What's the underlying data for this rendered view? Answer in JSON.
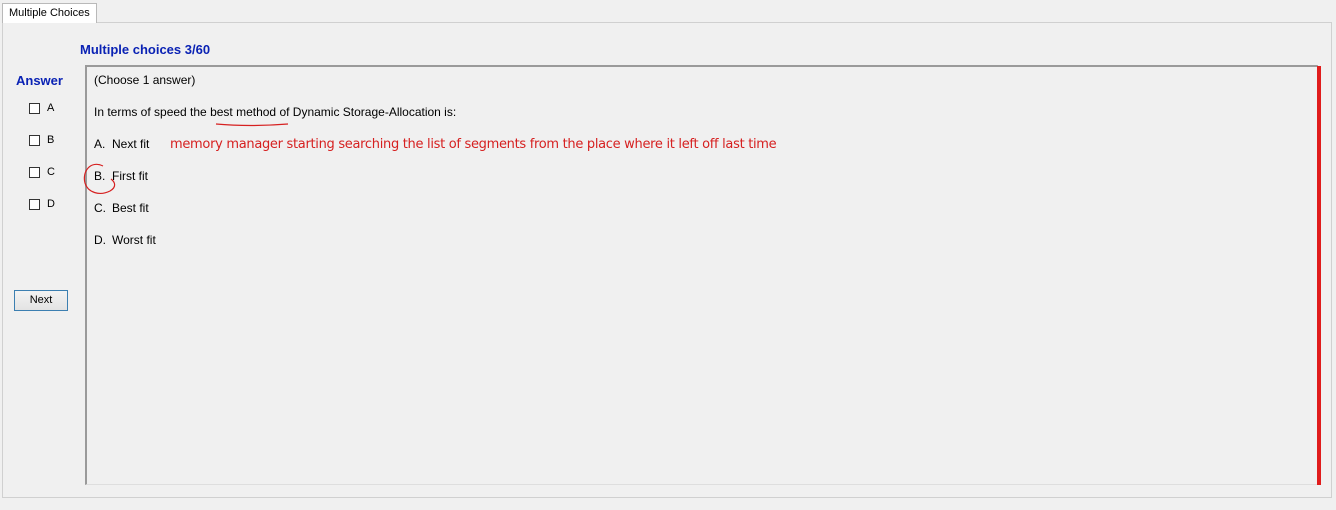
{
  "tab": {
    "label": "Multiple Choices"
  },
  "header": {
    "title": "Multiple choices 3/60"
  },
  "answer_panel": {
    "label": "Answer",
    "options": [
      {
        "letter": "A",
        "checked": false
      },
      {
        "letter": "B",
        "checked": false
      },
      {
        "letter": "C",
        "checked": false
      },
      {
        "letter": "D",
        "checked": false
      }
    ],
    "next_label": "Next"
  },
  "question": {
    "instruction": "(Choose 1 answer)",
    "text_prefix": "In terms of speed the ",
    "text_emphasis": "best method",
    "text_suffix": " of  Dynamic Storage-Allocation is:",
    "choices": [
      {
        "letter": "A.",
        "text": "Next fit"
      },
      {
        "letter": "B.",
        "text": "First fit"
      },
      {
        "letter": "C.",
        "text": "Best fit"
      },
      {
        "letter": "D.",
        "text": "Worst fit"
      }
    ]
  },
  "annotation": {
    "text": "memory manager starting searching the list of segments from the place where it left off last time"
  },
  "colors": {
    "title": "#0a22b4",
    "ink_red": "#d62020",
    "scrollbar_marker": "#e01c1c"
  }
}
